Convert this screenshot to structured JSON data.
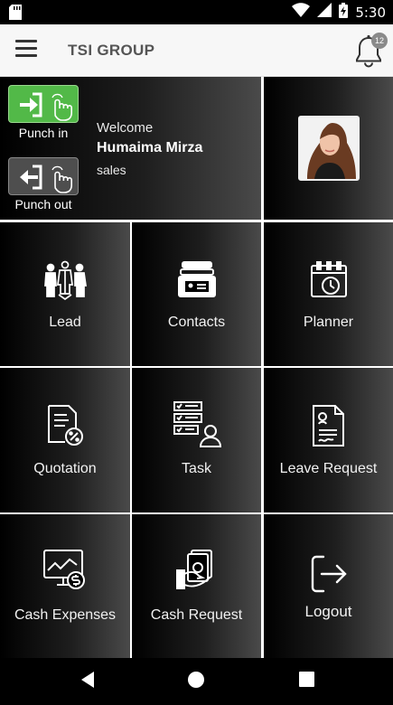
{
  "status_bar": {
    "time": "5:30",
    "icons": [
      "sd-card-icon",
      "wifi-icon",
      "signal-icon",
      "battery-charging-icon"
    ]
  },
  "header": {
    "title": "TSI GROUP",
    "menu_icon": "hamburger-menu-icon",
    "notification_icon": "bell-icon",
    "notification_count": "12"
  },
  "profile": {
    "punch_in_label": "Punch in",
    "punch_out_label": "Punch out",
    "welcome_text": "Welcome",
    "user_name": "Humaima Mirza",
    "user_role": "sales"
  },
  "tiles": [
    {
      "label": "Lead",
      "icon": "people-group-icon"
    },
    {
      "label": "Contacts",
      "icon": "contact-card-holder-icon"
    },
    {
      "label": "Planner",
      "icon": "calendar-clock-icon"
    },
    {
      "label": "Quotation",
      "icon": "document-percent-icon"
    },
    {
      "label": "Task",
      "icon": "checklist-person-icon"
    },
    {
      "label": "Leave Request",
      "icon": "document-signature-icon"
    },
    {
      "label": "Cash Expenses",
      "icon": "monitor-chart-dollar-icon"
    },
    {
      "label": "Cash Request",
      "icon": "hand-money-icon"
    },
    {
      "label": "Logout",
      "icon": "logout-arrow-icon"
    }
  ],
  "nav_bar": {
    "icons": [
      "back-triangle-icon",
      "home-circle-icon",
      "recents-square-icon"
    ]
  },
  "colors": {
    "punch_in_bg": "#52b948",
    "punch_out_bg": "#4e4e4e",
    "tile_gradient_start": "#000000",
    "tile_gradient_end": "#4a4a4a"
  }
}
